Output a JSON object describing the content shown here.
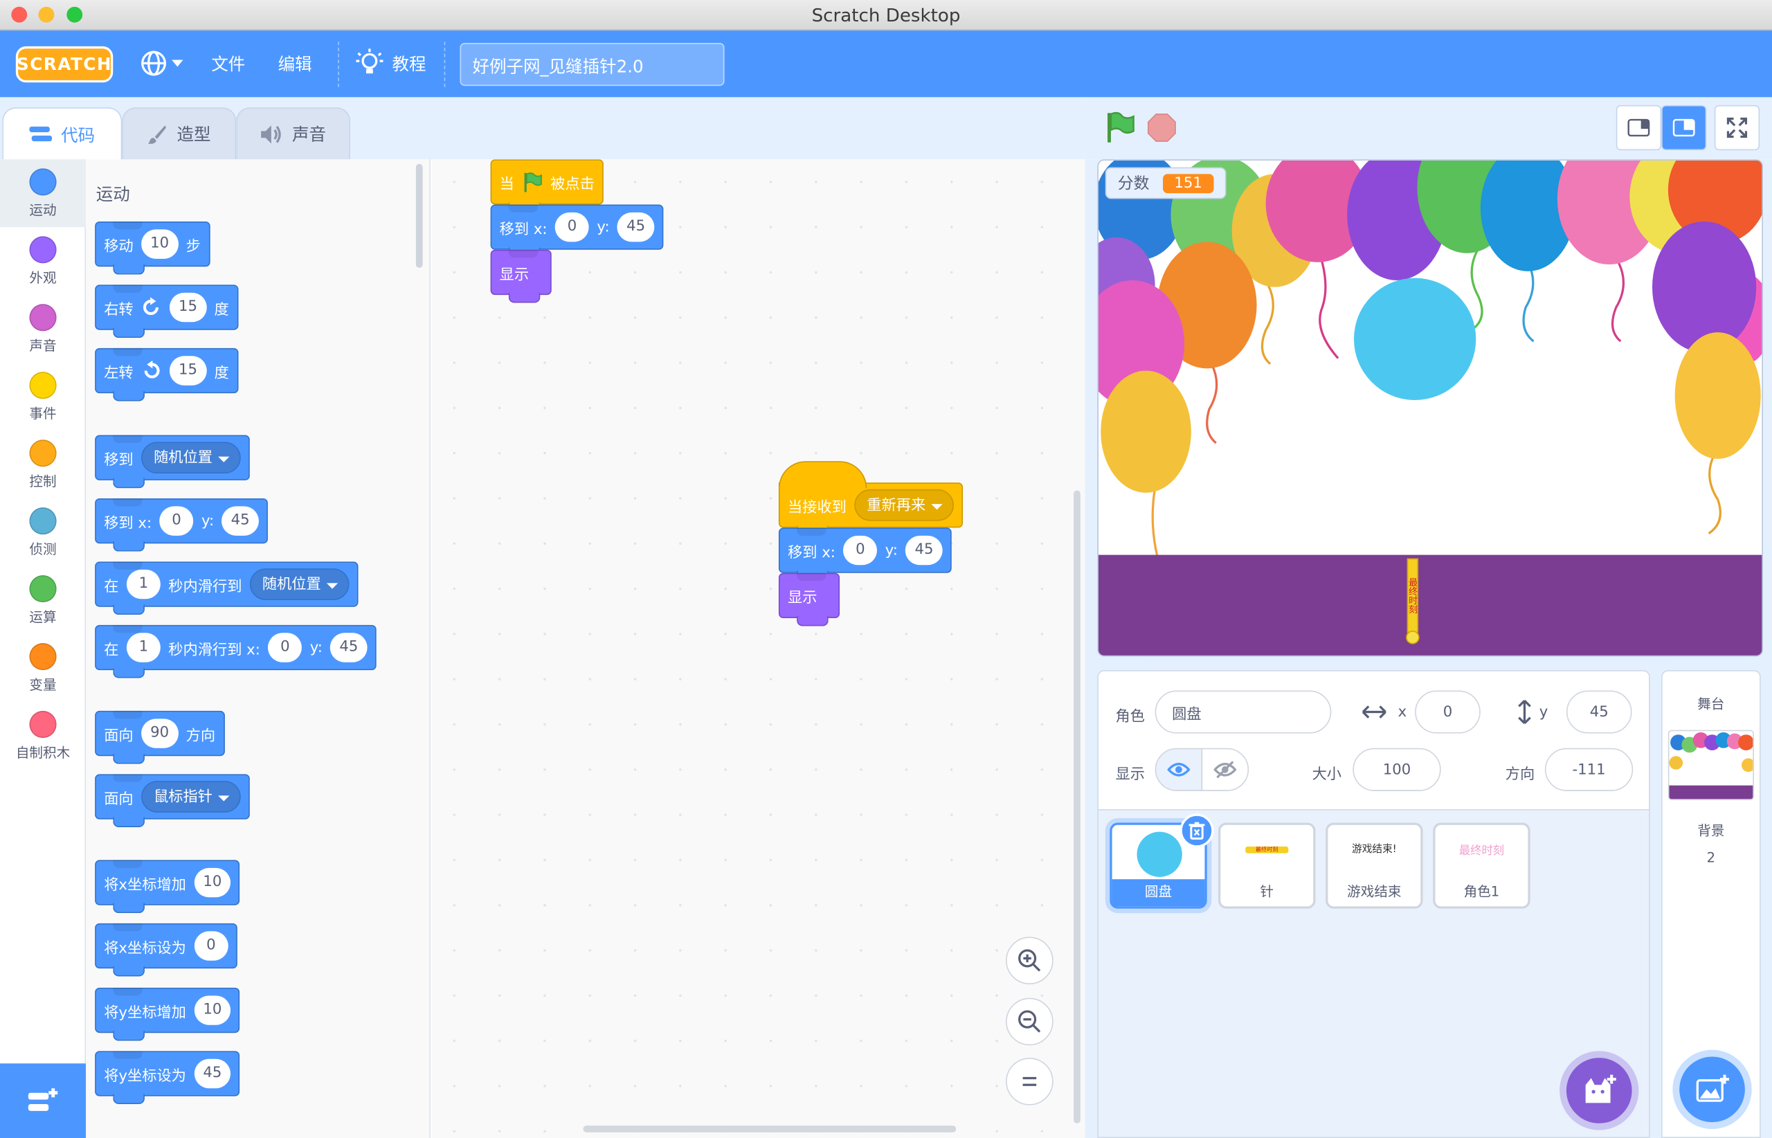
{
  "window": {
    "title": "Scratch Desktop"
  },
  "menubar": {
    "logo_text": "SCRATCH",
    "file": "文件",
    "edit": "编辑",
    "tutorials": "教程",
    "project_title": "好例子网_见缝插针2.0"
  },
  "tabs": {
    "code": "代码",
    "costumes": "造型",
    "sounds": "声音"
  },
  "categories": [
    {
      "label": "运动",
      "color": "#4c97ff"
    },
    {
      "label": "外观",
      "color": "#9966ff"
    },
    {
      "label": "声音",
      "color": "#cf63cf"
    },
    {
      "label": "事件",
      "color": "#ffd500"
    },
    {
      "label": "控制",
      "color": "#ffab19"
    },
    {
      "label": "侦测",
      "color": "#5cb1d6"
    },
    {
      "label": "运算",
      "color": "#59c059"
    },
    {
      "label": "变量",
      "color": "#ff8c1a"
    },
    {
      "label": "自制积木",
      "color": "#ff6680"
    }
  ],
  "palette": {
    "heading": "运动",
    "move": {
      "label": "移动",
      "value": "10",
      "unit": "步"
    },
    "turn_right": {
      "label": "右转",
      "value": "15",
      "unit": "度"
    },
    "turn_left": {
      "label": "左转",
      "value": "15",
      "unit": "度"
    },
    "goto": {
      "label": "移到",
      "menu": "随机位置"
    },
    "goto_xy": {
      "label": "移到 x:",
      "x": "0",
      "ylabel": "y:",
      "y": "45"
    },
    "glide": {
      "label": "在",
      "secs": "1",
      "mid": "秒内滑行到",
      "menu": "随机位置"
    },
    "glide_xy": {
      "label": "在",
      "secs": "1",
      "mid": "秒内滑行到 x:",
      "x": "0",
      "ylabel": "y:",
      "y": "45"
    },
    "point_dir": {
      "label": "面向",
      "value": "90",
      "unit": "方向"
    },
    "point_towards": {
      "label": "面向",
      "menu": "鼠标指针"
    },
    "change_x": {
      "label": "将x坐标增加",
      "value": "10"
    },
    "set_x": {
      "label": "将x坐标设为",
      "value": "0"
    },
    "change_y": {
      "label": "将y坐标增加",
      "value": "10"
    },
    "set_y": {
      "label": "将y坐标设为",
      "value": "45"
    }
  },
  "scripts": {
    "script1": {
      "hat_pre": "当",
      "hat_post": "被点击",
      "goto_label": "移到 x:",
      "x": "0",
      "ylabel": "y:",
      "y": "45",
      "show": "显示"
    },
    "script2": {
      "hat_label": "当接收到",
      "message": "重新再来",
      "goto_label": "移到 x:",
      "x": "0",
      "ylabel": "y:",
      "y": "45",
      "show": "显示"
    }
  },
  "stage": {
    "monitor_label": "分数",
    "monitor_value": "151",
    "pin_text": "最终时刻",
    "bg_color": "#7a3d91"
  },
  "sprite_info": {
    "sprite_label": "角色",
    "sprite_name": "圆盘",
    "x_label": "x",
    "x": "0",
    "y_label": "y",
    "y": "45",
    "show_label": "显示",
    "size_label": "大小",
    "size": "100",
    "direction_label": "方向",
    "direction": "-111"
  },
  "sprites": [
    {
      "name": "圆盘",
      "selected": true
    },
    {
      "name": "针",
      "thumb_text": "最终时刻"
    },
    {
      "name": "游戏结束",
      "thumb_text": "游戏结束!"
    },
    {
      "name": "角色1",
      "thumb_text": "最终时刻"
    }
  ],
  "stage_pane": {
    "title": "舞台",
    "backdrops_label": "背景",
    "backdrops_count": "2"
  }
}
